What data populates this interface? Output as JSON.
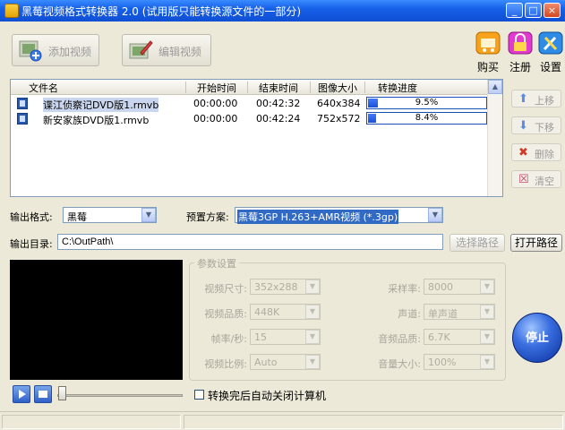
{
  "window": {
    "title": "黑莓视频格式转换器 2.0 (试用版只能转换源文件的一部分)",
    "min_label": "_",
    "max_label": "□",
    "close_label": "×"
  },
  "toolbar": {
    "add_video_label": "添加视频",
    "edit_video_label": "编辑视频",
    "buy_label": "购买",
    "register_label": "注册",
    "settings_label": "设置"
  },
  "file_list": {
    "columns": [
      "文件名",
      "开始时间",
      "结束时间",
      "图像大小",
      "转换进度"
    ],
    "rows": [
      {
        "name": "谍江侦察记DVD版1.rmvb",
        "start": "00:00:00",
        "end": "00:42:32",
        "size": "640x384",
        "progress_label": "9.5%",
        "progress": 0.095,
        "selected": true
      },
      {
        "name": "新安家族DVD版1.rmvb",
        "start": "00:00:00",
        "end": "00:42:24",
        "size": "752x572",
        "progress_label": "8.4%",
        "progress": 0.084,
        "selected": false
      }
    ]
  },
  "side_buttons": {
    "up_label": "上移",
    "down_label": "下移",
    "delete_label": "删除",
    "clear_label": "清空"
  },
  "output": {
    "format_label": "输出格式:",
    "format_value": "黑莓",
    "preset_label": "预置方案:",
    "preset_value": "黑莓3GP H.263+AMR视频 (*.3gp)",
    "dir_label": "输出目录:",
    "dir_value": "C:\\OutPath\\",
    "choose_path_label": "选择路径",
    "open_path_label": "打开路径"
  },
  "params": {
    "group_title": "参数设置",
    "video_size_label": "视频尺寸:",
    "video_size_value": "352x288",
    "video_quality_label": "视频品质:",
    "video_quality_value": "448K",
    "fps_label": "帧率/秒:",
    "fps_value": "15",
    "aspect_label": "视频比例:",
    "aspect_value": "Auto",
    "sample_rate_label": "采样率:",
    "sample_rate_value": "8000",
    "channels_label": "声道:",
    "channels_value": "单声道",
    "audio_quality_label": "音频品质:",
    "audio_quality_value": "6.7K",
    "volume_label": "音量大小:",
    "volume_value": "100%"
  },
  "stop_label": "停止",
  "shutdown_label": "转换完后自动关闭计算机",
  "colors": {
    "title_bar": "#1660e8",
    "progress": "#1d4fd6",
    "window_bg": "#ece9d8"
  }
}
